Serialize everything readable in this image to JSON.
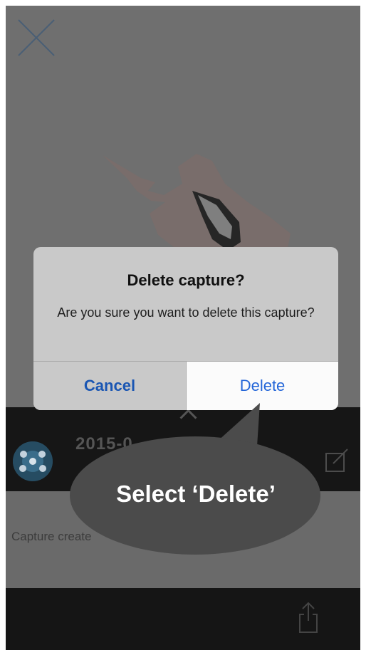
{
  "dialog": {
    "title": "Delete capture?",
    "message": "Are you sure you want to delete this capture?",
    "cancel_label": "Cancel",
    "delete_label": "Delete"
  },
  "capture": {
    "date_partial": "2015-0",
    "created_text_partial": "Capture create"
  },
  "callout": {
    "text": "Select ‘Delete’"
  },
  "icons": {
    "close": "close-icon",
    "edit": "edit-icon",
    "share": "share-icon",
    "avatar": "avatar-icon"
  },
  "colors": {
    "dialog_button_blue": "#2466d8",
    "overlay_gray": "#6d6d6d",
    "dark_bar": "#161616"
  }
}
